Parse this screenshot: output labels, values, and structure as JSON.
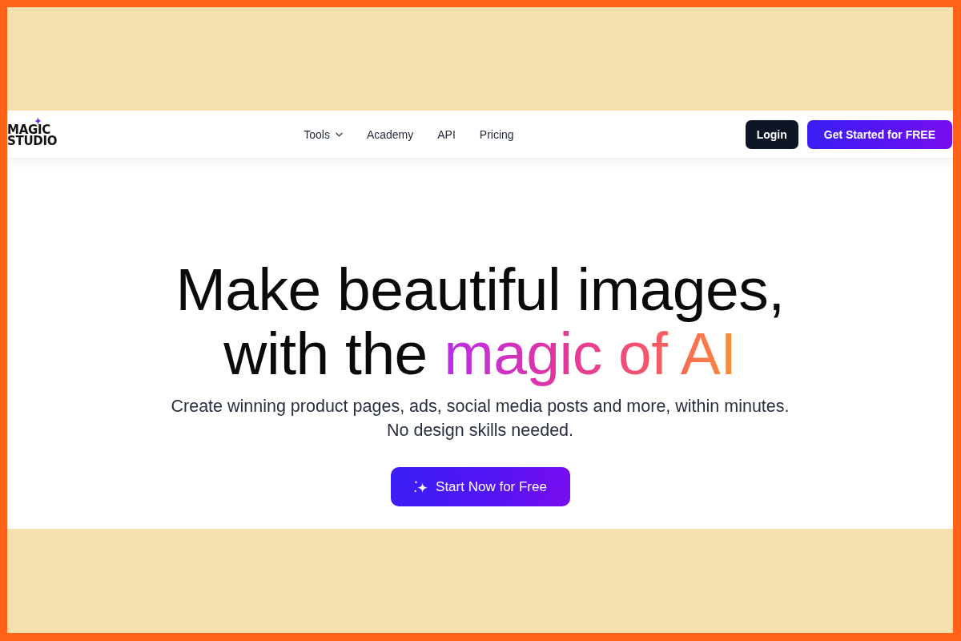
{
  "logo": {
    "text": "MAGIC STUDIO"
  },
  "nav": [
    {
      "label": "Tools",
      "kind": "dropdown"
    },
    {
      "label": "Academy",
      "kind": "link"
    },
    {
      "label": "API",
      "kind": "link"
    },
    {
      "label": "Pricing",
      "kind": "link"
    }
  ],
  "actions": [
    {
      "label": "Login",
      "kind": "secondary"
    },
    {
      "label": "Get Started for FREE",
      "kind": "primary"
    }
  ],
  "hero": {
    "headline": "Make beautiful images, with the",
    "highlight": "magic of AI",
    "subtitle": [
      "Create winning product pages, ads, social media posts and more, within minutes.",
      "No design skills needed."
    ],
    "cta": {
      "label": "Start Now for Free"
    }
  }
}
